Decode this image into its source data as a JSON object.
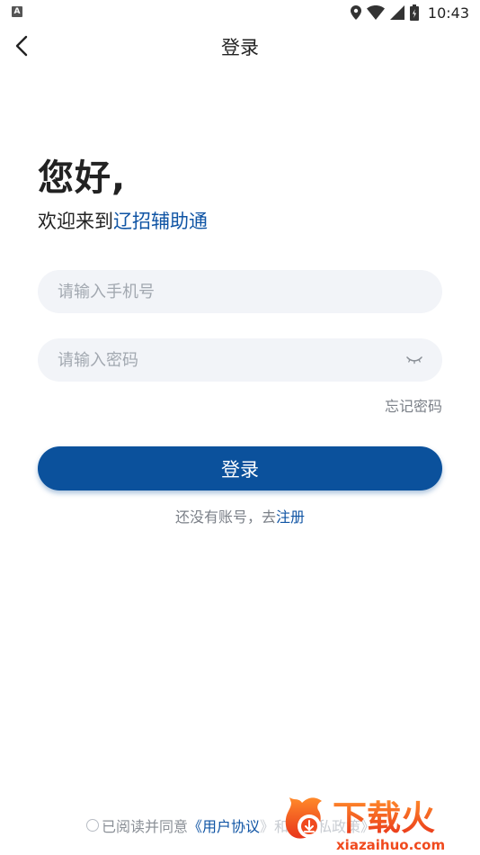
{
  "status_bar": {
    "indicator": "A",
    "time": "10:43",
    "icons": [
      "location-icon",
      "wifi-icon",
      "signal-icon",
      "battery-icon"
    ]
  },
  "header": {
    "title": "登录"
  },
  "greeting": {
    "title": "您好,",
    "welcome_prefix": "欢迎来到",
    "app_name": "辽招辅助通"
  },
  "form": {
    "phone_placeholder": "请输入手机号",
    "password_placeholder": "请输入密码",
    "forgot_label": "忘记密码",
    "login_label": "登录",
    "register_prefix": "还没有账号，去",
    "register_link": "注册"
  },
  "agreement": {
    "prefix": "已阅读并同意",
    "user_agreement": "《用户协议",
    "rest": "》和《隐私政策》"
  },
  "watermark": {
    "brand": "下载火",
    "site": "xiazaihuo.com"
  },
  "colors": {
    "accent": "#0f54a4",
    "button": "#0b519c",
    "input_bg": "#f2f4f8",
    "placeholder": "#a2a8b0",
    "secondary_text": "#7b8088",
    "watermark": "#f04a1e"
  }
}
